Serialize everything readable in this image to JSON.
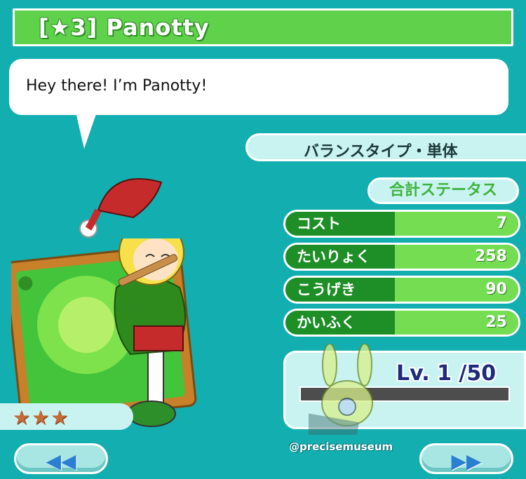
{
  "header": {
    "title": "[★3] Panotty"
  },
  "dialog": {
    "text": "Hey there! I’m Panotty!"
  },
  "card": {
    "type_label": "バランスタイプ・単体",
    "total_label": "合計ステータス",
    "stats": [
      {
        "label": "コスト",
        "value": "7"
      },
      {
        "label": "たいりょく",
        "value": "258"
      },
      {
        "label": "こうげき",
        "value": "90"
      },
      {
        "label": "かいふく",
        "value": "25"
      }
    ],
    "level_text": "Lv. 1 /50",
    "level_progress": 0,
    "rarity_stars": "★★★",
    "stars": 3
  },
  "nav": {
    "prev_icon": "rewind-icon",
    "next_icon": "fast-forward-icon"
  },
  "watermark": "@precisemuseum",
  "colors": {
    "background": "#12aeb0",
    "title_bar": "#5fd14a",
    "stat_fill": "#75dd52",
    "panel": "#c9f3f1"
  }
}
